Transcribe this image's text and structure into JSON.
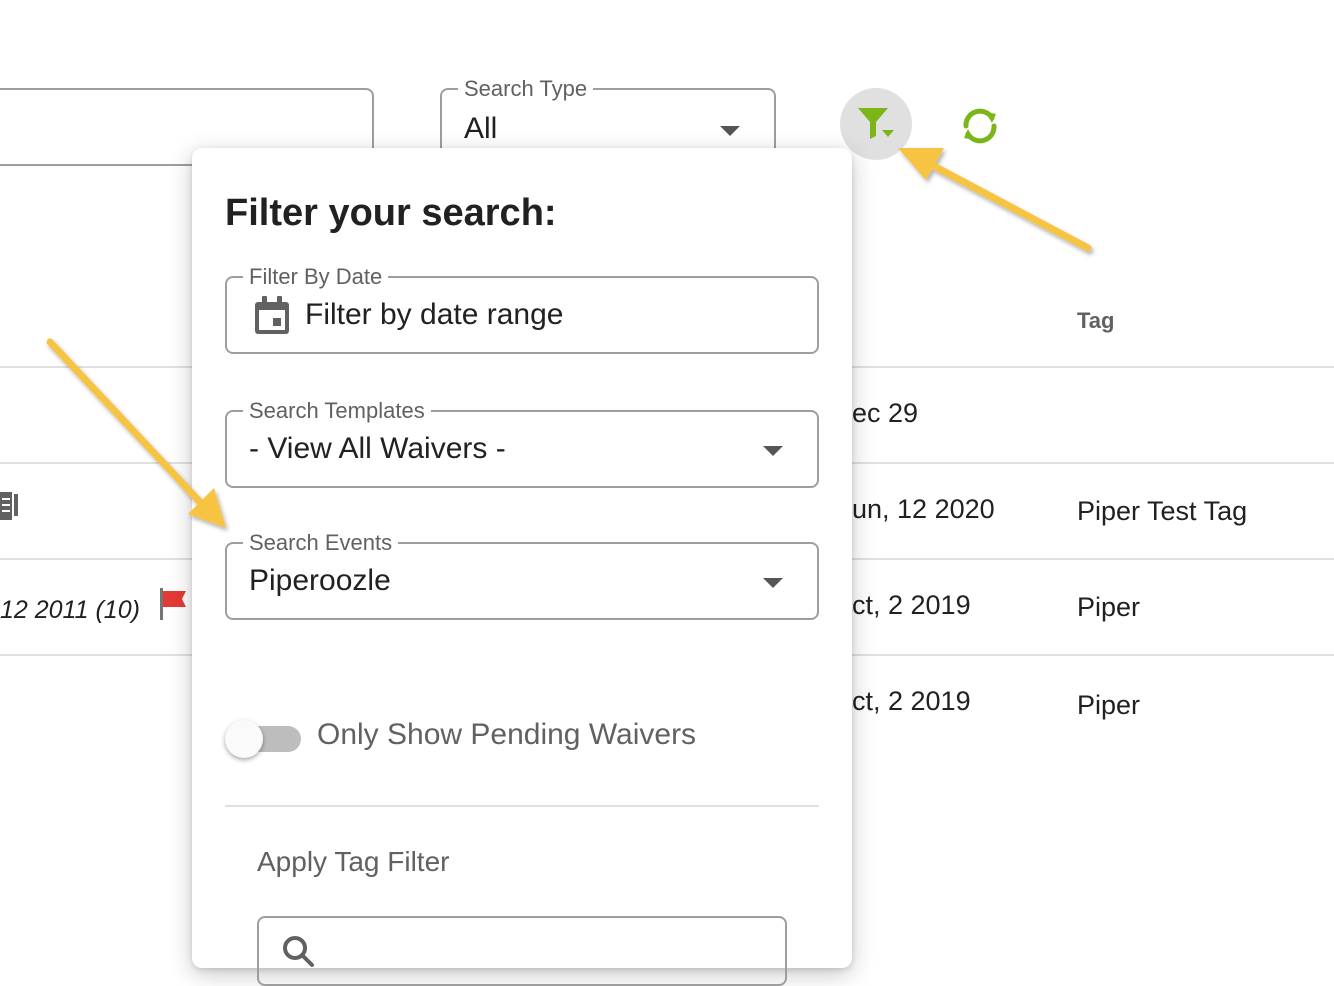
{
  "toolbar": {
    "search_type_label": "Search Type",
    "search_type_value": "All",
    "filter_icon": "filter-icon",
    "refresh_icon": "refresh-icon",
    "accent_color": "#7cb518"
  },
  "table": {
    "columns": {
      "tag": "Tag"
    },
    "rows": [
      {
        "date": "ec 29",
        "tag": ""
      },
      {
        "date": "un, 12 2020",
        "tag": "Piper Test Tag"
      },
      {
        "date": "ct, 2 2019",
        "tag": "Piper",
        "left_text": "12 2011 (10)"
      },
      {
        "date": "ct, 2 2019",
        "tag": "Piper"
      }
    ]
  },
  "filter_panel": {
    "title": "Filter your search:",
    "date_filter": {
      "label": "Filter By Date",
      "value": "Filter by date range"
    },
    "templates": {
      "label": "Search Templates",
      "value": "- View All Waivers -"
    },
    "events": {
      "label": "Search Events",
      "value": "Piperoozle"
    },
    "pending_toggle": {
      "label": "Only Show Pending Waivers",
      "checked": false
    },
    "tag_filter": {
      "label": "Apply Tag Filter"
    }
  },
  "annotation_color": "#f6c343"
}
